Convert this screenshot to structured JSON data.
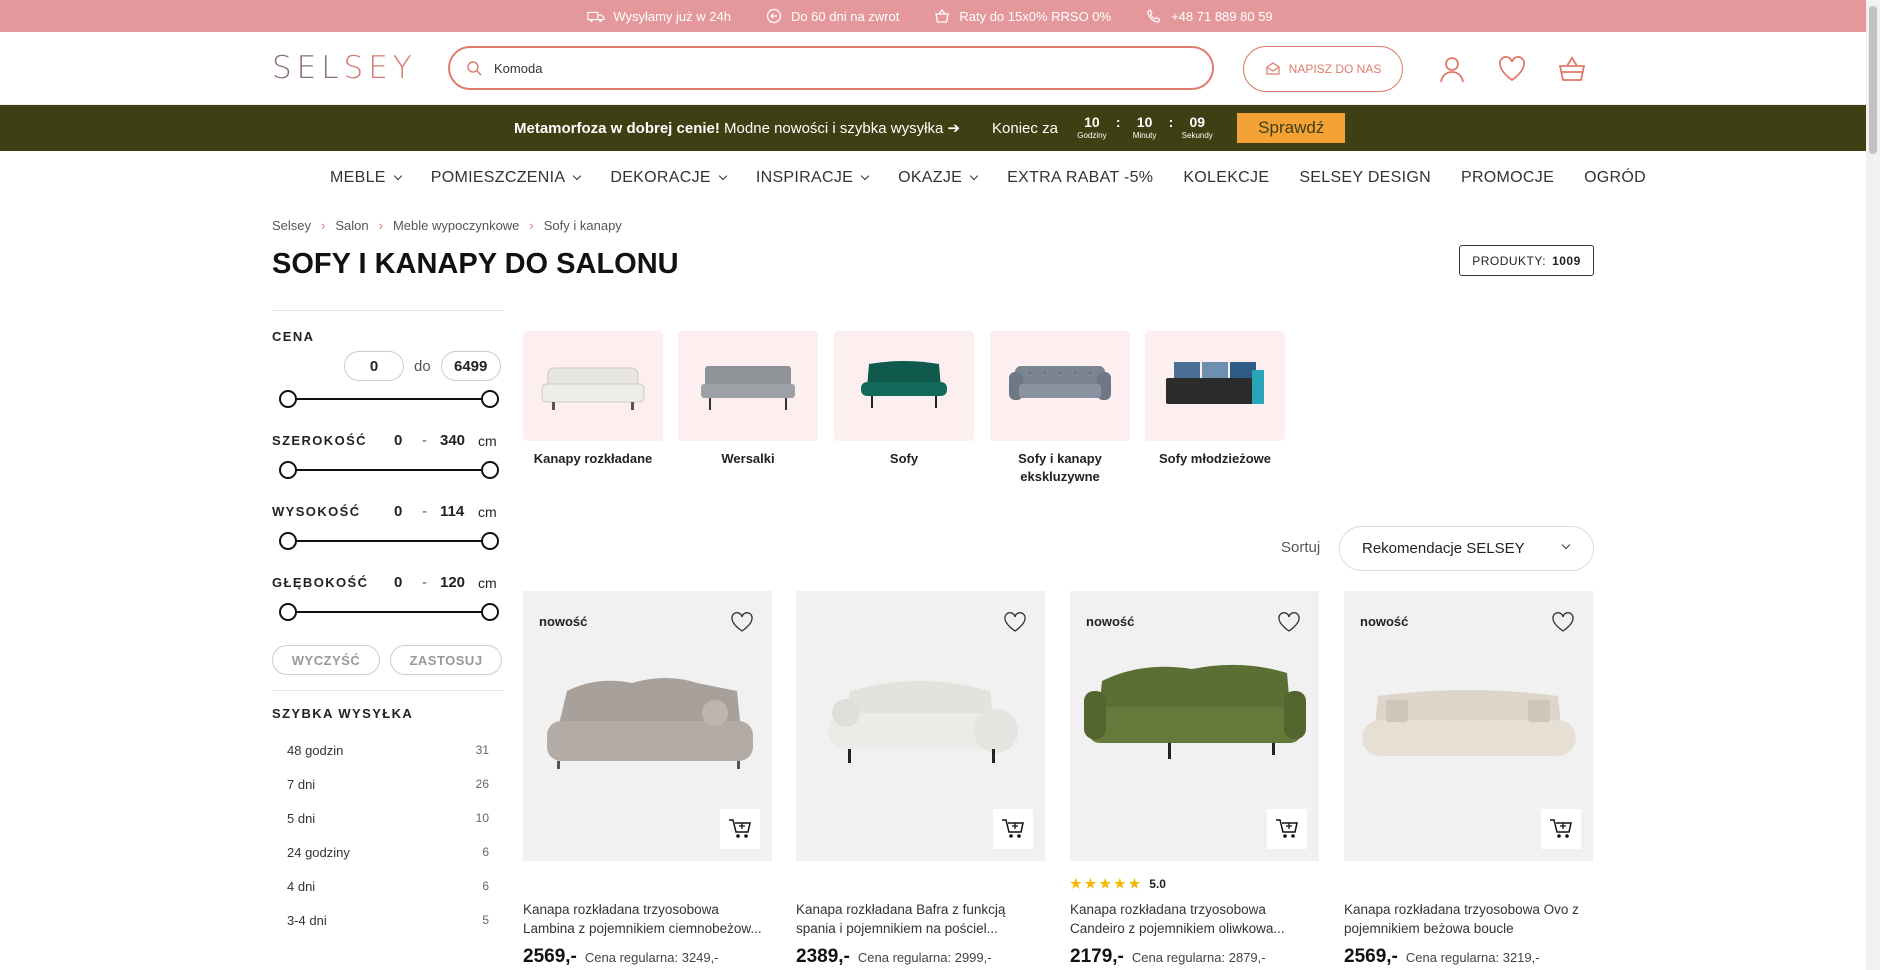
{
  "topbar": {
    "items": [
      {
        "icon": "truck-icon",
        "text": "Wysyłamy już w 24h"
      },
      {
        "icon": "return-icon",
        "text": "Do 60 dni na zwrot"
      },
      {
        "icon": "basket-icon",
        "text": "Raty do 15x0% RRSO 0%"
      },
      {
        "icon": "phone-icon",
        "text": "+48 71 889 80 59"
      }
    ]
  },
  "header": {
    "logo_part1": "SEL",
    "logo_part2": "SEY",
    "search_value": "Komoda",
    "contact_label": "NAPISZ DO NAS"
  },
  "promo": {
    "bold": "Metamorfoza w dobrej cenie!",
    "text": " Modne nowości i szybka wysyłka ➔",
    "countdown_label": "Koniec za",
    "hours": "10",
    "hours_label": "Godziny",
    "minutes": "10",
    "minutes_label": "Minuty",
    "seconds": "09",
    "seconds_label": "Sekundy",
    "cta": "Sprawdź"
  },
  "nav": {
    "items": [
      "MEBLE",
      "POMIESZCZENIA",
      "DEKORACJE",
      "INSPIRACJE",
      "OKAZJE",
      "EXTRA RABAT -5%",
      "KOLEKCJE",
      "SELSEY DESIGN",
      "PROMOCJE",
      "OGRÓD"
    ]
  },
  "breadcrumb": [
    "Selsey",
    "Salon",
    "Meble wypoczynkowe",
    "Sofy i kanapy"
  ],
  "page_title": "SOFY I KANAPY DO SALONU",
  "products_count": {
    "label": "PRODUKTY:",
    "value": "1009"
  },
  "filters": {
    "price": {
      "title": "CENA",
      "min": "0",
      "sep": "do",
      "max": "6499"
    },
    "width": {
      "title": "SZEROKOŚĆ",
      "min": "0",
      "sep": "-",
      "max": "340",
      "unit": "cm"
    },
    "height": {
      "title": "WYSOKOŚĆ",
      "min": "0",
      "sep": "-",
      "max": "114",
      "unit": "cm"
    },
    "depth": {
      "title": "GŁĘBOKOŚĆ",
      "min": "0",
      "sep": "-",
      "max": "120",
      "unit": "cm"
    },
    "clear_label": "WYCZYŚĆ",
    "apply_label": "ZASTOSUJ",
    "shipping_title": "SZYBKA WYSYŁKA",
    "shipping": [
      {
        "label": "48 godzin",
        "count": "31"
      },
      {
        "label": "7 dni",
        "count": "26"
      },
      {
        "label": "5 dni",
        "count": "10"
      },
      {
        "label": "24 godziny",
        "count": "6"
      },
      {
        "label": "4 dni",
        "count": "6"
      },
      {
        "label": "3-4 dni",
        "count": "5"
      }
    ]
  },
  "categories": [
    {
      "label": "Kanapy rozkładane",
      "color": "#e8e6e2"
    },
    {
      "label": "Wersalki",
      "color": "#8f9296"
    },
    {
      "label": "Sofy",
      "color": "#0f5a4c"
    },
    {
      "label": "Sofy i kanapy ekskluzywne",
      "color": "#7b8591"
    },
    {
      "label": "Sofy młodzieżowe",
      "color": "#2b2b2b"
    }
  ],
  "sort": {
    "label": "Sortuj",
    "value": "Rekomendacje SELSEY"
  },
  "products": [
    {
      "badge": "nowość",
      "name": "Kanapa rozkładana trzyosobowa Lambina z pojemnikiem ciemnobeżow...",
      "price": "2569,-",
      "regular": "Cena regularna: 3249,-",
      "color": "#a8a09a",
      "rating": ""
    },
    {
      "badge": "",
      "name": "Kanapa rozkładana Bafra z funkcją spania i pojemnikiem na pościel...",
      "price": "2389,-",
      "regular": "Cena regularna: 2999,-",
      "color": "#e9e7e2",
      "rating": ""
    },
    {
      "badge": "nowość",
      "name": "Kanapa rozkładana trzyosobowa Candeiro z pojemnikiem oliwkowa...",
      "price": "2179,-",
      "regular": "Cena regularna: 2879,-",
      "color": "#5b6e33",
      "rating": "5.0"
    },
    {
      "badge": "nowość",
      "name": "Kanapa rozkładana trzyosobowa Ovo z pojemnikiem beżowa boucle",
      "price": "2569,-",
      "regular": "Cena regularna: 3219,-",
      "color": "#e4ddd2",
      "rating": ""
    }
  ]
}
